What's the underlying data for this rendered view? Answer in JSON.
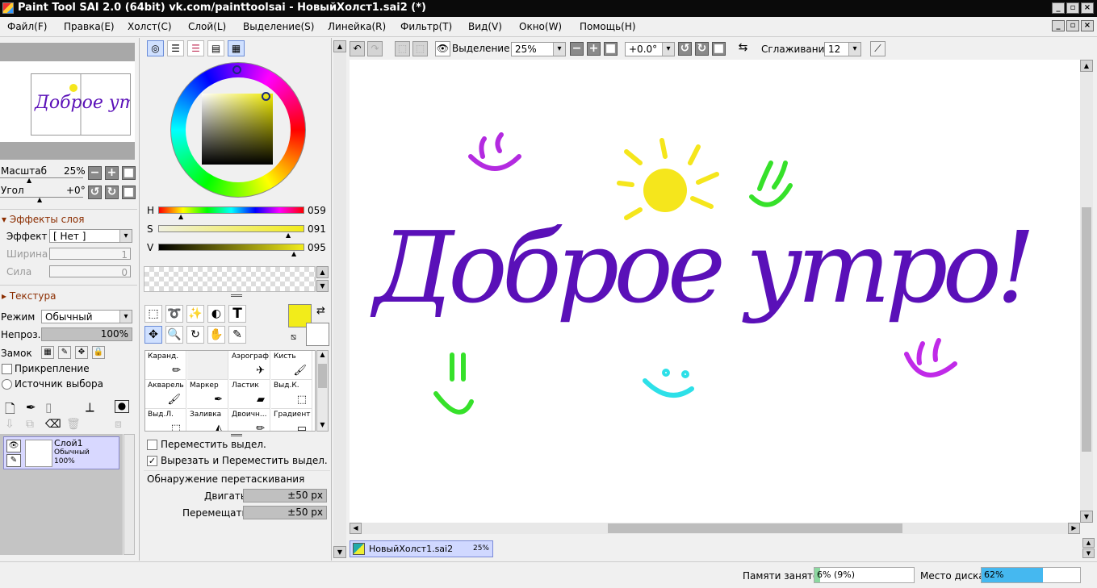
{
  "window": {
    "title": "Paint Tool SAI 2.0 (64bit) vk.com/painttoolsai - НовыйХолст1.sai2 (*)"
  },
  "menu": [
    "Файл(F)",
    "Правка(E)",
    "Холст(C)",
    "Слой(L)",
    "Выделение(S)",
    "Линейка(R)",
    "Фильтр(T)",
    "Вид(V)",
    "Окно(W)",
    "Помощь(H)"
  ],
  "navigator": {
    "scale_label": "Масштаб",
    "scale_value": "25%",
    "angle_label": "Угол",
    "angle_value": "+0°"
  },
  "layer_effects": {
    "title": "Эффекты слоя",
    "effect_label": "Эффект",
    "effect_value": "[ Нет ]",
    "width_label": "Ширина",
    "width_value": "1",
    "strength_label": "Сила",
    "strength_value": "0"
  },
  "texture": {
    "title": "Текстура"
  },
  "layer_props": {
    "mode_label": "Режим",
    "mode_value": "Обычный",
    "opacity_label": "Непроз.",
    "opacity_value": "100%",
    "lock_label": "Замок",
    "clipping_label": "Прикрепление",
    "selection_source_label": "Источник выбора"
  },
  "layers": [
    {
      "name": "Слой1",
      "mode": "Обычный",
      "opacity": "100%"
    }
  ],
  "color": {
    "h_label": "H",
    "h_value": "059",
    "s_label": "S",
    "s_value": "091",
    "v_label": "V",
    "v_value": "095",
    "primary": "#f2ec1a",
    "secondary": "#ffffff"
  },
  "brushes": [
    {
      "name": "Каранд.",
      "icon": "pencil-icon"
    },
    {
      "name": "",
      "icon": ""
    },
    {
      "name": "Аэрограф",
      "icon": "airbrush-icon"
    },
    {
      "name": "Кисть",
      "icon": "brush-icon"
    },
    {
      "name": "Акварель",
      "icon": "watercolor-icon"
    },
    {
      "name": "Маркер",
      "icon": "marker-icon"
    },
    {
      "name": "Ластик",
      "icon": "eraser-icon"
    },
    {
      "name": "Выд.К.",
      "icon": "select-pen-icon"
    },
    {
      "name": "Выд.Л.",
      "icon": "select-eraser-icon"
    },
    {
      "name": "Заливка",
      "icon": "fill-icon"
    },
    {
      "name": "Двоичн...",
      "icon": "binary-icon"
    },
    {
      "name": "Градиент",
      "icon": "gradient-icon"
    }
  ],
  "move_options": {
    "move_selection": "Переместить выдел.",
    "cut_move_selection": "Вырезать и Переместить выдел.",
    "drag_detect": "Обнаружение перетаскивания",
    "move_label": "Двигать",
    "move_value": "±50 px",
    "shift_label": "Перемещать",
    "shift_value": "±50 px"
  },
  "toolbar": {
    "selection_label": "Выделение",
    "zoom_value": "25%",
    "angle_value": "+0.0°",
    "smoothing_label": "Сглаживание",
    "smoothing_value": "12"
  },
  "canvas_art": {
    "text": "Доброе утро!",
    "text_color": "#5a10b8",
    "sun_color": "#f5e61c"
  },
  "doc_tabs": [
    {
      "name": "НовыйХолст1.sai2",
      "zoom": "25%"
    }
  ],
  "status": {
    "memory_label": "Памяти занято",
    "memory_value": "6% (9%)",
    "memory_fraction": 0.06,
    "disk_label": "Место диска",
    "disk_value": "62%",
    "disk_fraction": 0.62
  }
}
